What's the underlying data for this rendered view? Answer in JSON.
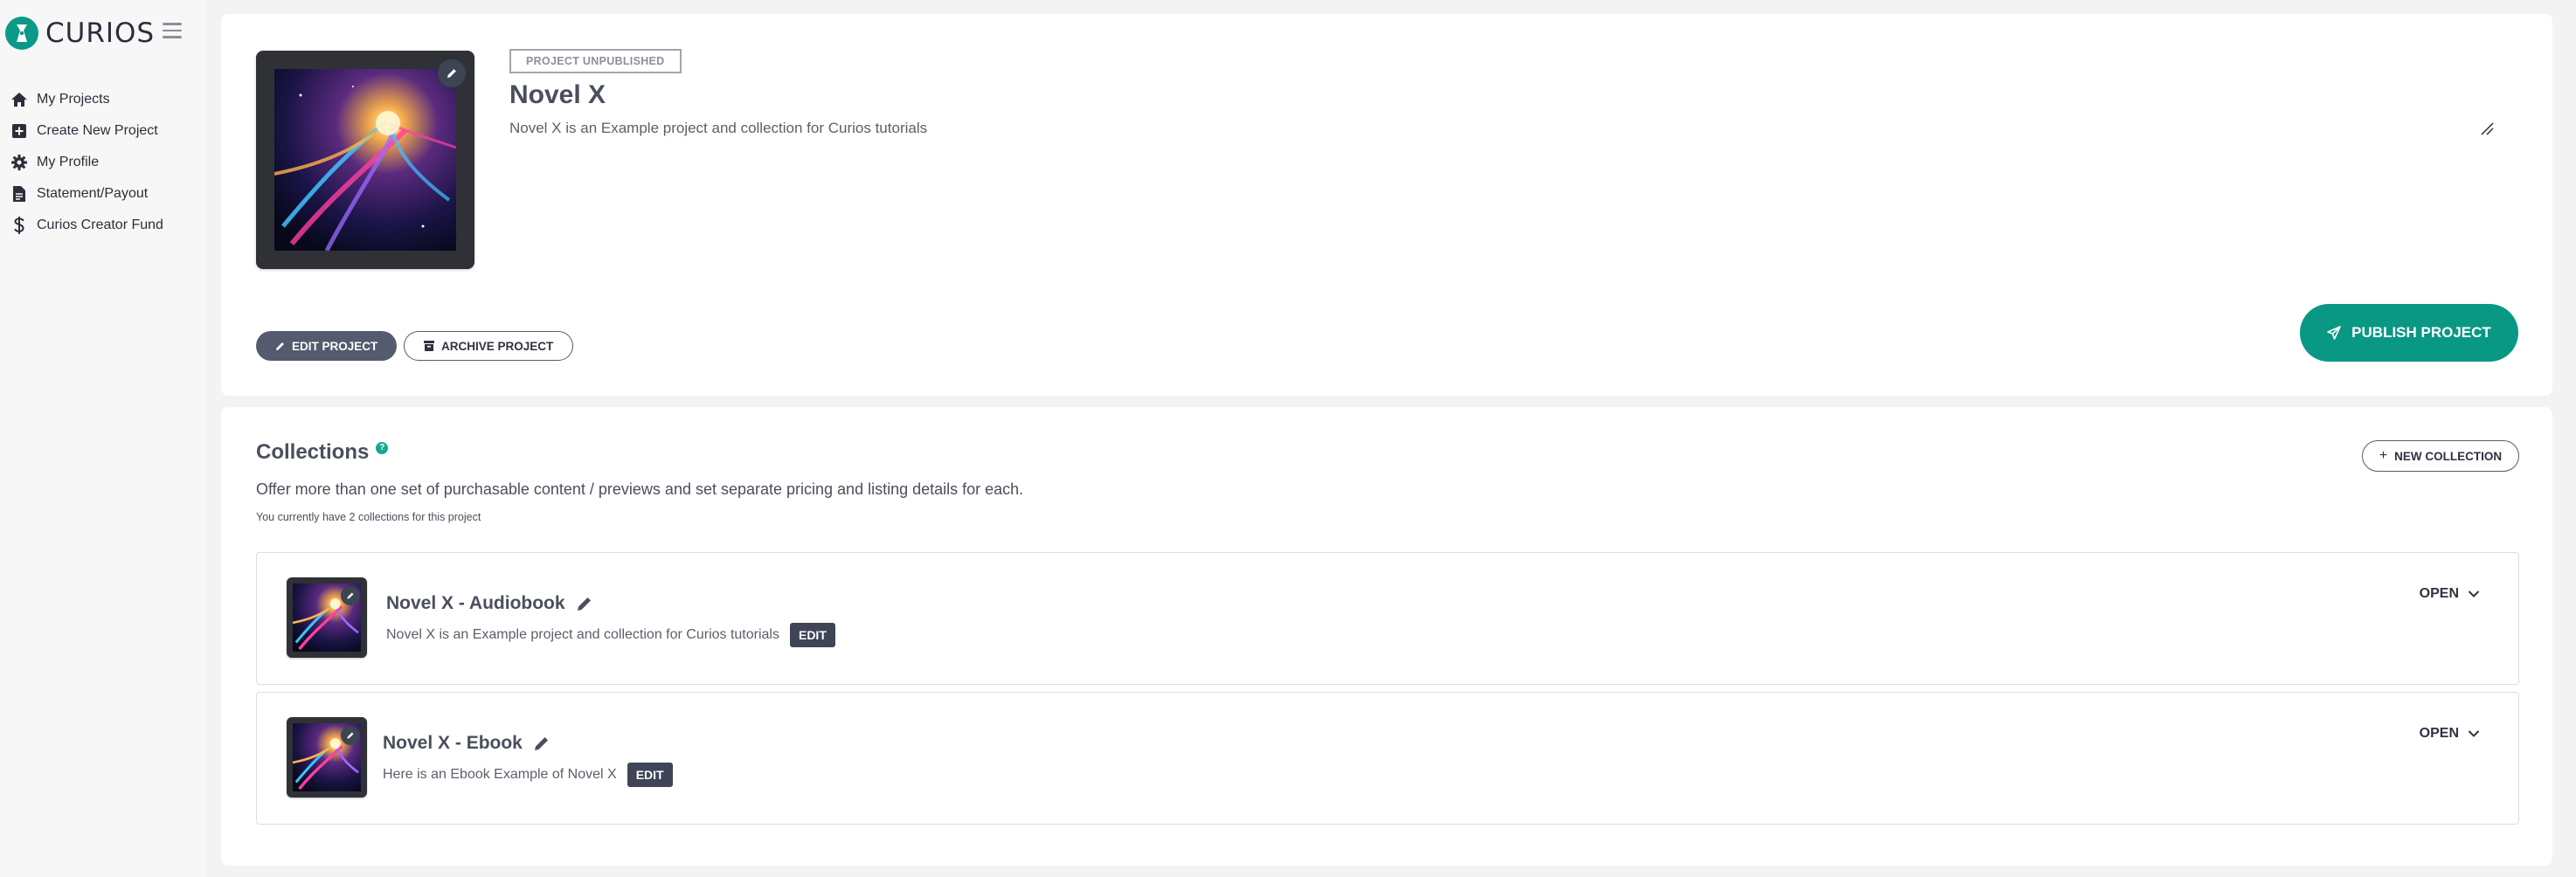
{
  "sidebar": {
    "brand": "CURIOS",
    "items": [
      {
        "label": "My Projects",
        "icon": "home-icon"
      },
      {
        "label": "Create New Project",
        "icon": "plus-square-icon"
      },
      {
        "label": "My Profile",
        "icon": "gear-icon"
      },
      {
        "label": "Statement/Payout",
        "icon": "document-icon"
      },
      {
        "label": "Curios Creator Fund",
        "icon": "dollar-icon"
      }
    ]
  },
  "project": {
    "status_badge": "PROJECT UNPUBLISHED",
    "title": "Novel X",
    "description": "Novel X is an Example project and collection for Curios tutorials",
    "edit_button": "EDIT PROJECT",
    "archive_button": "ARCHIVE PROJECT",
    "publish_button": "PUBLISH PROJECT"
  },
  "collections": {
    "title": "Collections",
    "help_glyph": "?",
    "new_button": "NEW COLLECTION",
    "description": "Offer more than one set of purchasable content / previews and set separate pricing and listing details for each.",
    "count_text": "You currently have 2 collections for this project",
    "items": [
      {
        "title": "Novel X - Audiobook",
        "description": "Novel X is an Example project and collection for Curios tutorials",
        "edit_label": "EDIT",
        "open_label": "OPEN"
      },
      {
        "title": "Novel X - Ebook",
        "description": "Here is an Ebook Example of Novel X",
        "edit_label": "EDIT",
        "open_label": "OPEN"
      }
    ]
  },
  "colors": {
    "accent": "#099883",
    "dark_button": "#545b6f",
    "text": "#4a4f5c"
  }
}
